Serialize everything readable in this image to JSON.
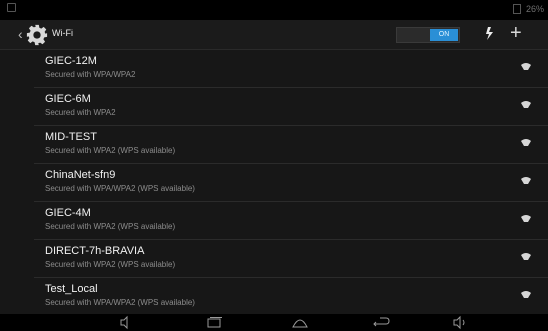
{
  "status_bar": {
    "right_text": "26%"
  },
  "action_bar": {
    "title": "Wi-Fi",
    "toggle_label": "ON"
  },
  "networks": [
    {
      "ssid": "GIEC-12M",
      "security": "Secured with WPA/WPA2"
    },
    {
      "ssid": "GIEC-6M",
      "security": "Secured with WPA2"
    },
    {
      "ssid": "MID-TEST",
      "security": "Secured with WPA2 (WPS available)"
    },
    {
      "ssid": "ChinaNet-sfn9",
      "security": "Secured with WPA/WPA2 (WPS available)"
    },
    {
      "ssid": "GIEC-4M",
      "security": "Secured with WPA2 (WPS available)"
    },
    {
      "ssid": "DIRECT-7h-BRAVIA",
      "security": "Secured with WPA2 (WPS available)"
    },
    {
      "ssid": "Test_Local",
      "security": "Secured with WPA/WPA2 (WPS available)"
    }
  ],
  "icons": {
    "settings": "gear-icon",
    "scan": "scan-icon",
    "add": "add-icon",
    "signal": "wifi-signal-icon",
    "nav": [
      "volume-down-icon",
      "recents-icon",
      "home-icon",
      "back-icon",
      "volume-up-icon"
    ]
  }
}
